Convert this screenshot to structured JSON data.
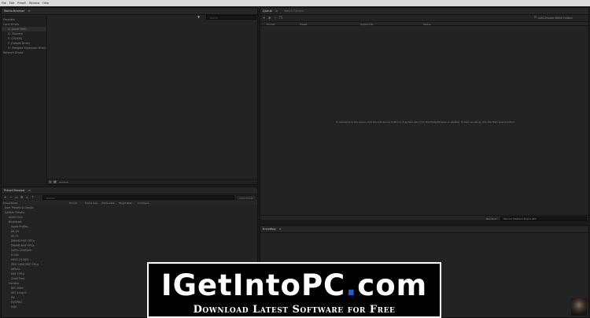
{
  "menubar": {
    "items": [
      "File",
      "Edit",
      "Preset",
      "Window",
      "Help"
    ]
  },
  "media_browser": {
    "title": "Media Browser",
    "sections": {
      "favorites": "Favorites",
      "local_drives": "Local Drives",
      "network_drives": "Network Drives"
    },
    "drives": [
      "C: (Local Disk)",
      "D: (Shared)",
      "E: (VISION)",
      "F: (Google Drive)",
      "G: (Seagate Expansion Drive)"
    ],
    "search_placeholder": "Search"
  },
  "queue": {
    "title": "Queue",
    "tab2": "Watch Folders",
    "auto_encode_label": "Auto-Encode Watch Folders",
    "columns": [
      "Format",
      "Preset",
      "Output File",
      "Status"
    ],
    "empty_message": "To add items to the queue, click the Add Source button or drag files here from the Media Browser or desktop. To start encoding, click the Start Queue button."
  },
  "preset_browser": {
    "title": "Preset Browser",
    "search_placeholder": "Search",
    "apply_label": "Apply Preset",
    "columns": [
      "Preset Name",
      "Format",
      "Frame Size",
      "Frame Rate",
      "Target Rate",
      "Comment"
    ],
    "user_presets": "User Presets & Groups",
    "system_presets": "System Presets",
    "items": [
      "Audio Only",
      "Broadcast",
      "Apple ProRes",
      "AS-10",
      "AS-11",
      "DNxHD MXF OP1a",
      "DNxHR MXF OP1a",
      "GoPro CineForm",
      "H.264",
      "HEVC (H.265)",
      "JPEG 2000 MXF OP1a",
      "MPEG2",
      "MXF OP1a",
      "QuickTime",
      "Camera",
      "AVC-Intra",
      "AVC-Long-G",
      "DV",
      "DVCPRO",
      "HDV"
    ]
  },
  "encoding": {
    "title": "Encoding"
  },
  "renderer_label": "Renderer:",
  "renderer_value": "Mercury Playback Engine GPU",
  "banner": {
    "title_main": "IGetIntoPC",
    "title_dot": ".",
    "title_tld": "com",
    "subtitle": "Download Latest Software for Free"
  },
  "colors": {
    "banner_blue": "#1a5fd9",
    "panel_bg": "#232323"
  }
}
